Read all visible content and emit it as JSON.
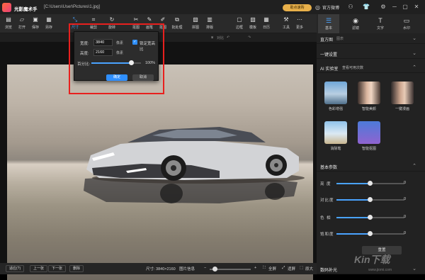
{
  "app": {
    "title": "光影魔术手",
    "path": "[C:\\Users\\User\\Pictures\\1.jpg]",
    "vip_label": "助点速购",
    "login_label": "官方微博"
  },
  "toolbar": {
    "items": [
      {
        "label": "浏览",
        "icon": "folder-icon"
      },
      {
        "label": "打开",
        "icon": "open-icon"
      },
      {
        "label": "保存",
        "icon": "save-icon"
      },
      {
        "label": "另存",
        "icon": "save-as-icon"
      },
      {
        "label": "尺寸",
        "icon": "resize-icon"
      },
      {
        "label": "裁剪",
        "icon": "crop-icon"
      },
      {
        "label": "旋转",
        "icon": "rotate-icon"
      },
      {
        "label": "抠图",
        "icon": "cutout-icon"
      },
      {
        "label": "画笔",
        "icon": "brush-icon"
      },
      {
        "label": "抠图",
        "icon": "matting-icon"
      },
      {
        "label": "批处理",
        "icon": "batch-icon"
      },
      {
        "label": "拼图",
        "icon": "collage-icon"
      },
      {
        "label": "排版",
        "icon": "layout-icon"
      },
      {
        "label": "边框",
        "icon": "border-icon"
      },
      {
        "label": "模板",
        "icon": "template-icon"
      },
      {
        "label": "日历",
        "icon": "calendar-icon"
      },
      {
        "label": "工具",
        "icon": "tools-icon"
      },
      {
        "label": "更多",
        "icon": "more-icon"
      }
    ]
  },
  "subtoolbar": {
    "compare": "对比",
    "undo": "↶",
    "redo": "↷"
  },
  "right_tabs": [
    {
      "label": "基本",
      "icon": "adjust-icon"
    },
    {
      "label": "滤镜",
      "icon": "filter-icon"
    },
    {
      "label": "文字",
      "icon": "text-icon"
    },
    {
      "label": "水印",
      "icon": "watermark-icon"
    }
  ],
  "panel": {
    "histogram_title": "直方图",
    "histogram_sub": "图表",
    "auto_title": "一键设置",
    "ai_title": "AI 实验室",
    "ai_link": "查看可用次数",
    "ai_tools": [
      {
        "label": "色彩增强",
        "icon": "color-enhance-icon"
      },
      {
        "label": "智能美颜",
        "icon": "beauty-icon"
      },
      {
        "label": "一键漫画",
        "icon": "cartoon-icon"
      },
      {
        "label": "消除笔",
        "icon": "eraser-icon"
      },
      {
        "label": "智能抠图",
        "icon": "smart-cutout-icon"
      }
    ],
    "basic_title": "基本参数",
    "sliders": [
      {
        "label": "亮 度",
        "value": "0"
      },
      {
        "label": "对比度",
        "value": "0"
      },
      {
        "label": "色 相",
        "value": "0"
      },
      {
        "label": "饱和度",
        "value": "0"
      }
    ],
    "reset_label": "重置",
    "fill_light_title": "数码补光"
  },
  "dialog": {
    "width_label": "宽度:",
    "width_value": "3840",
    "height_label": "高度:",
    "height_value": "2160",
    "unit": "像素",
    "keep_ratio_label": "锁定宽高比",
    "percent_label": "百分比:",
    "percent_value": "100%",
    "percent": 0.8,
    "ok_label": "确定",
    "cancel_label": "取消"
  },
  "bottom": {
    "zoom_select": "适应(?)",
    "prev": "上一张",
    "next": "下一张",
    "delete": "删除",
    "size_text": "尺寸: 3840×2160",
    "info_label": "图片信息",
    "fullscreen": "全屏",
    "fit": "适屏",
    "original": "原大",
    "zoom_level": 0.12
  },
  "colors": {
    "accent": "#4aa3ff",
    "highlight_frame": "#e8201e",
    "vip_gold": "#e8b04a"
  },
  "watermark": {
    "main": "Kin下载",
    "sub": "www.jiomi.com"
  }
}
